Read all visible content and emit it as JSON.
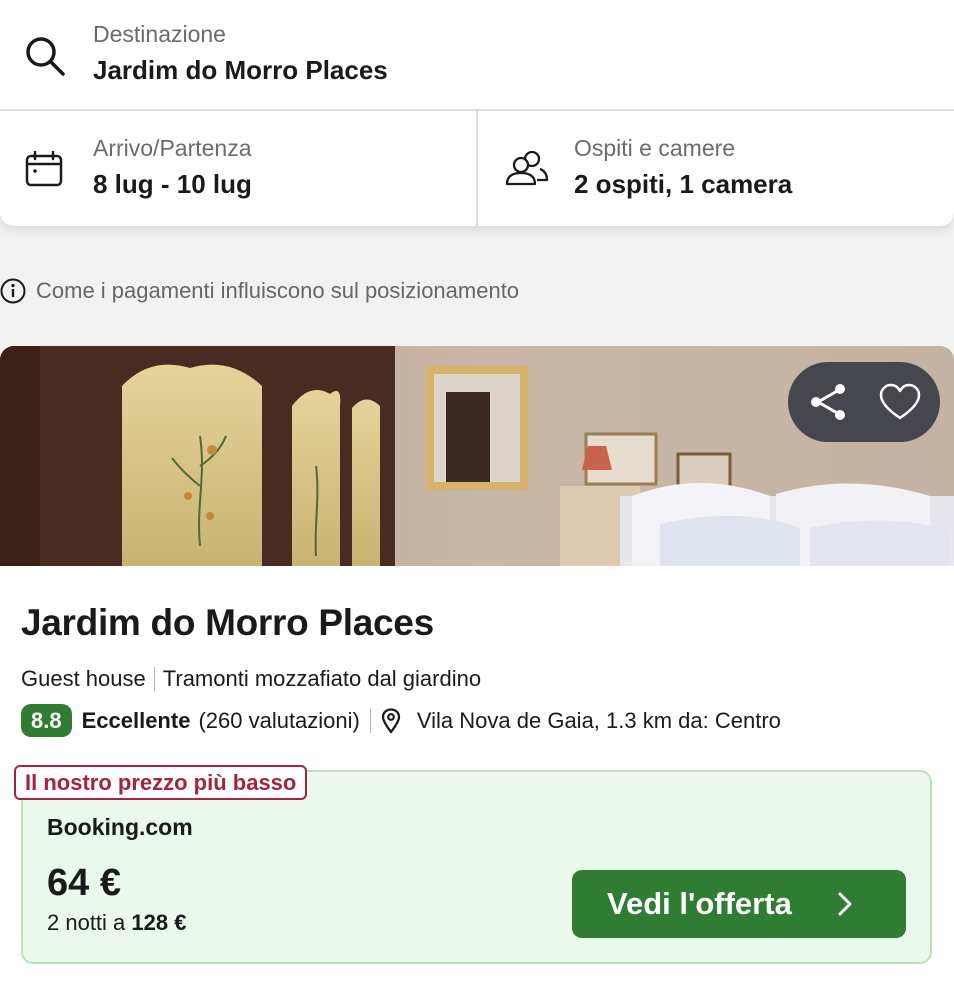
{
  "search": {
    "destination_label": "Destinazione",
    "destination_value": "Jardim do Morro Places",
    "dates_label": "Arrivo/Partenza",
    "dates_value": "8 lug - 10 lug",
    "guests_label": "Ospiti e camere",
    "guests_value": "2 ospiti, 1 camera"
  },
  "info": {
    "ranking_text": "Come i pagamenti influiscono sul posizionamento"
  },
  "hotel": {
    "name": "Jardim do Morro Places",
    "type": "Guest house",
    "highlight": "Tramonti mozzafiato dal giardino",
    "rating": "8.8",
    "rating_word": "Eccellente",
    "rating_count": "(260 valutazioni)",
    "location": "Vila Nova de Gaia, 1.3 km da: Centro"
  },
  "offer": {
    "badge": "Il nostro prezzo più basso",
    "provider": "Booking.com",
    "price": "64 €",
    "nights_text": "2 notti a ",
    "total": "128 €",
    "cta": "Vedi l'offerta"
  },
  "colors": {
    "accent_green": "#2e7d32",
    "offer_bg": "#ebf8ec",
    "badge_red": "#a3243d"
  },
  "icons": [
    "search-icon",
    "calendar-icon",
    "guests-icon",
    "info-icon",
    "share-icon",
    "heart-icon",
    "location-pin-icon",
    "chevron-right-icon"
  ]
}
